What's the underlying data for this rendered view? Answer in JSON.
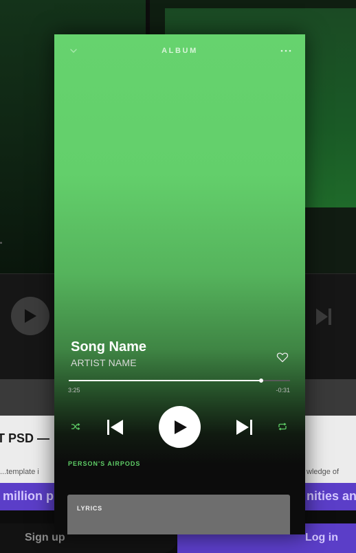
{
  "background": {
    "heading_fragment": "T PSD — L",
    "text_fragment_left": "...template i",
    "text_fragment_right": "wledge of",
    "banner_left": "million p",
    "banner_right": "nities an",
    "signup_label": "Sign up",
    "login_label": "Log in"
  },
  "player": {
    "header_title": "ALBUM",
    "chevron_icon": "chevron-down-icon",
    "more_icon": "more-horizontal-icon",
    "song_title": "Song Name",
    "artist": "ARTIST NAME",
    "favorite_icon": "heart-icon",
    "progress": {
      "elapsed": "3:25",
      "remaining": "-0:31",
      "fraction": 0.87
    },
    "controls": {
      "shuffle_icon": "shuffle-icon",
      "previous_icon": "skip-previous-icon",
      "play_icon": "play-icon",
      "next_icon": "skip-next-icon",
      "repeat_icon": "repeat-icon"
    },
    "device": "PERSON'S AIRPODS",
    "lyrics_label": "LYRICS"
  },
  "colors": {
    "accent_green": "#5fce67",
    "album_green": "#66d36e",
    "brand_purple": "#5b3ec8"
  }
}
